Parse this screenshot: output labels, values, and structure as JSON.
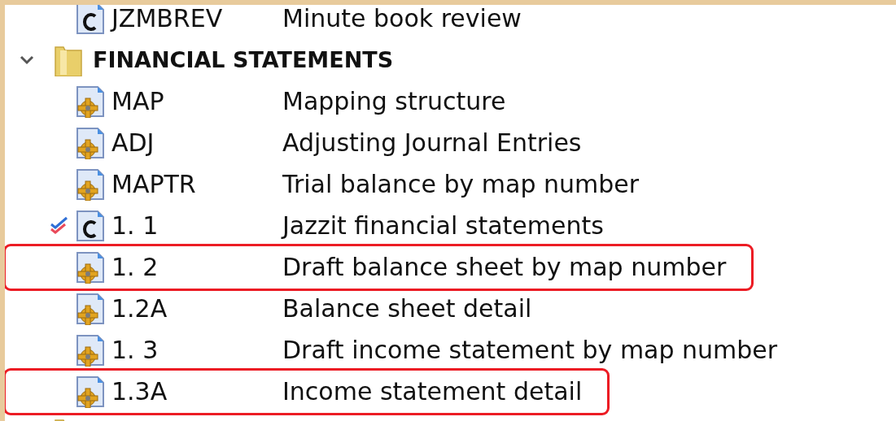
{
  "tree": {
    "items": [
      {
        "kind": "c",
        "code": "JZMBREV",
        "description": "Minute book review",
        "checked": false,
        "highlighted": false
      },
      {
        "kind": "folder",
        "label": "FINANCIAL STATEMENTS",
        "expanded": true,
        "children": [
          {
            "kind": "gear",
            "code": "MAP",
            "description": "Mapping structure",
            "checked": false,
            "highlighted": false
          },
          {
            "kind": "gear",
            "code": "ADJ",
            "description": "Adjusting Journal Entries",
            "checked": false,
            "highlighted": false
          },
          {
            "kind": "gear",
            "code": "MAPTR",
            "description": "Trial balance by map number",
            "checked": false,
            "highlighted": false
          },
          {
            "kind": "c",
            "code": "1. 1",
            "description": "Jazzit financial statements",
            "checked": true,
            "highlighted": false
          },
          {
            "kind": "gear",
            "code": "1. 2",
            "description": "Draft balance sheet by map number",
            "checked": false,
            "highlighted": true
          },
          {
            "kind": "gear",
            "code": "1.2A",
            "description": "Balance sheet detail",
            "checked": false,
            "highlighted": false
          },
          {
            "kind": "gear",
            "code": "1. 3",
            "description": "Draft income statement by map number",
            "checked": false,
            "highlighted": false
          },
          {
            "kind": "gear",
            "code": "1.3A",
            "description": "Income statement detail",
            "checked": false,
            "highlighted": true
          }
        ]
      },
      {
        "kind": "folder"
      }
    ]
  }
}
